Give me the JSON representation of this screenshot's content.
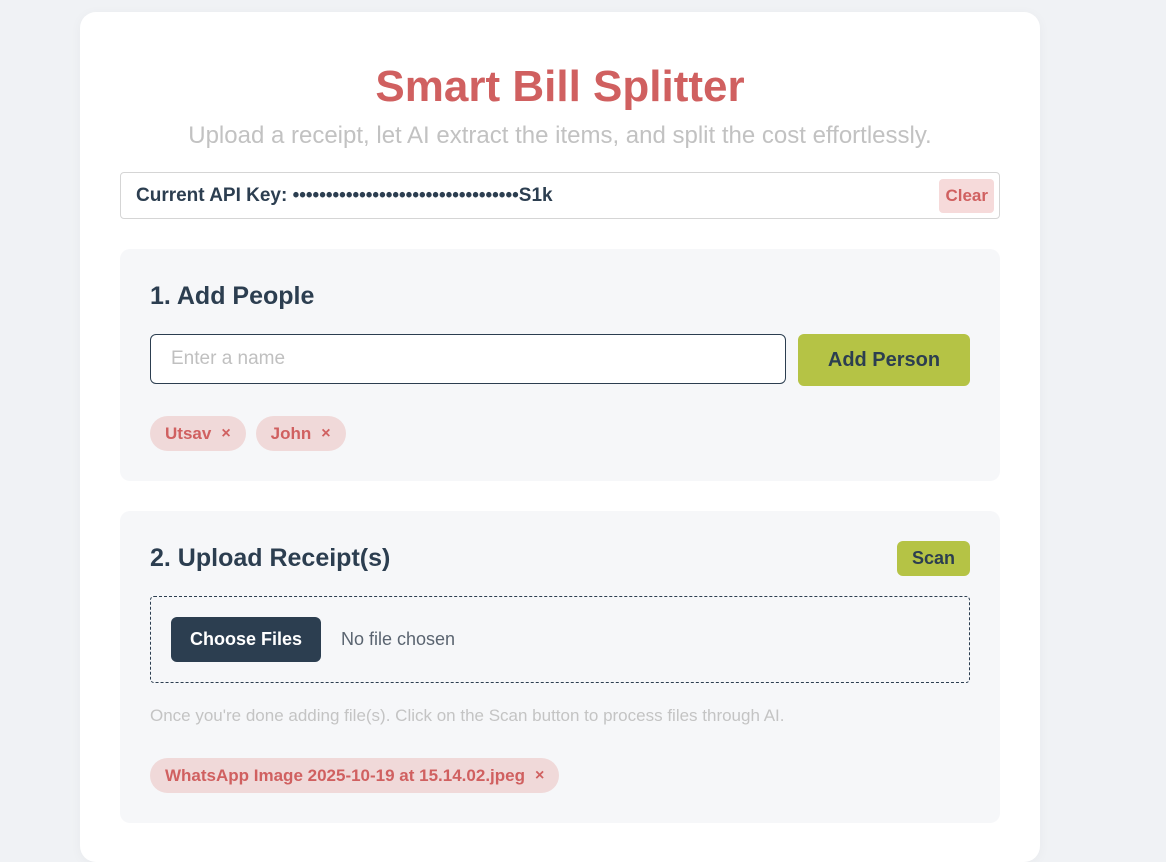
{
  "header": {
    "title": "Smart Bill Splitter",
    "subtitle": "Upload a receipt, let AI extract the items, and split the cost effortlessly."
  },
  "api_key": {
    "label_text": "Current API Key: ••••••••••••••••••••••••••••••••••S1k",
    "clear_label": "Clear"
  },
  "people_section": {
    "title": "1. Add People",
    "name_input_placeholder": "Enter a name",
    "name_input_value": "",
    "add_button_label": "Add Person",
    "people": [
      {
        "name": "Utsav",
        "remove_glyph": "×"
      },
      {
        "name": "John",
        "remove_glyph": "×"
      }
    ]
  },
  "upload_section": {
    "title": "2. Upload Receipt(s)",
    "scan_button_label": "Scan",
    "choose_files_label": "Choose Files",
    "file_status": "No file chosen",
    "hint": "Once you're done adding file(s). Click on the Scan button to process files through AI.",
    "files": [
      {
        "name": "WhatsApp Image 2025-10-19 at 15.14.02.jpeg",
        "remove_glyph": "×"
      }
    ]
  },
  "colors": {
    "accent": "#d06060",
    "primary_button": "#b5c345",
    "dark": "#2c3e50",
    "chip_bg": "#f0d9d9"
  },
  "icons": {
    "remove": "close-icon"
  }
}
